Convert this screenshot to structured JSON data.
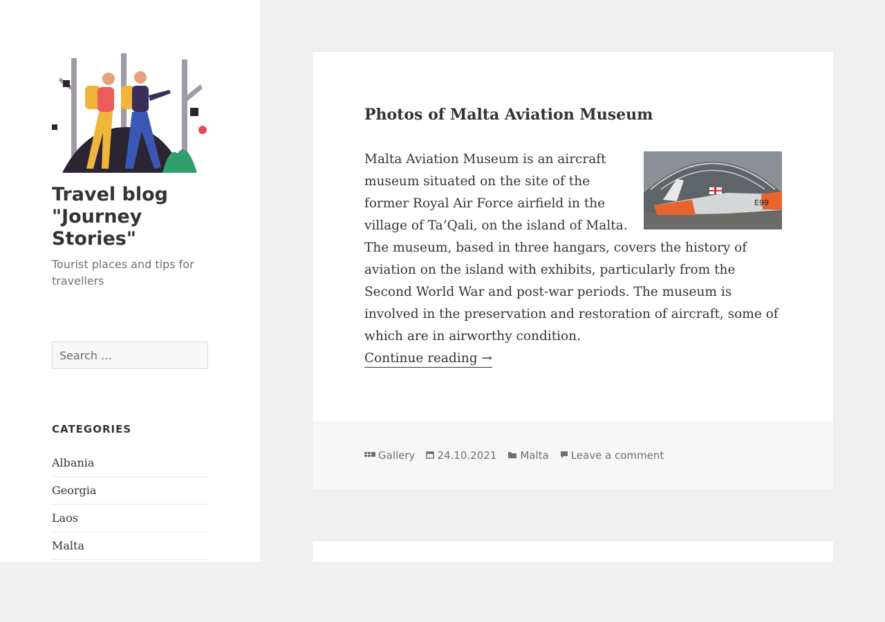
{
  "site": {
    "title": "Travel blog \"Journey Stories\"",
    "tagline": "Tourist places and tips for travellers"
  },
  "search": {
    "placeholder": "Search …"
  },
  "categories": {
    "heading": "CATEGORIES",
    "items": [
      "Albania",
      "Georgia",
      "Laos",
      "Malta"
    ]
  },
  "post": {
    "title": "Photos of Malta Aviation Museum",
    "excerpt": "Malta Aviation Museum is an aircraft museum situated on the site of the former Royal Air Force airfield in the village of Ta’Qali, on the island of Malta. The museum, based in three hangars, covers the history of aviation on the island with exhibits, particularly from the Second World War and post-war periods. The museum is involved in the preservation and restoration of aircraft, some of which are in airworthy condition.",
    "continue_label": "Continue reading →",
    "format": "Gallery",
    "date": "24.10.2021",
    "category": "Malta",
    "comments": "Leave a comment",
    "thumbnail_label": "E99"
  },
  "colors": {
    "accent": "#333333",
    "meta": "#707070",
    "page_bg": "#f0f0f0"
  }
}
